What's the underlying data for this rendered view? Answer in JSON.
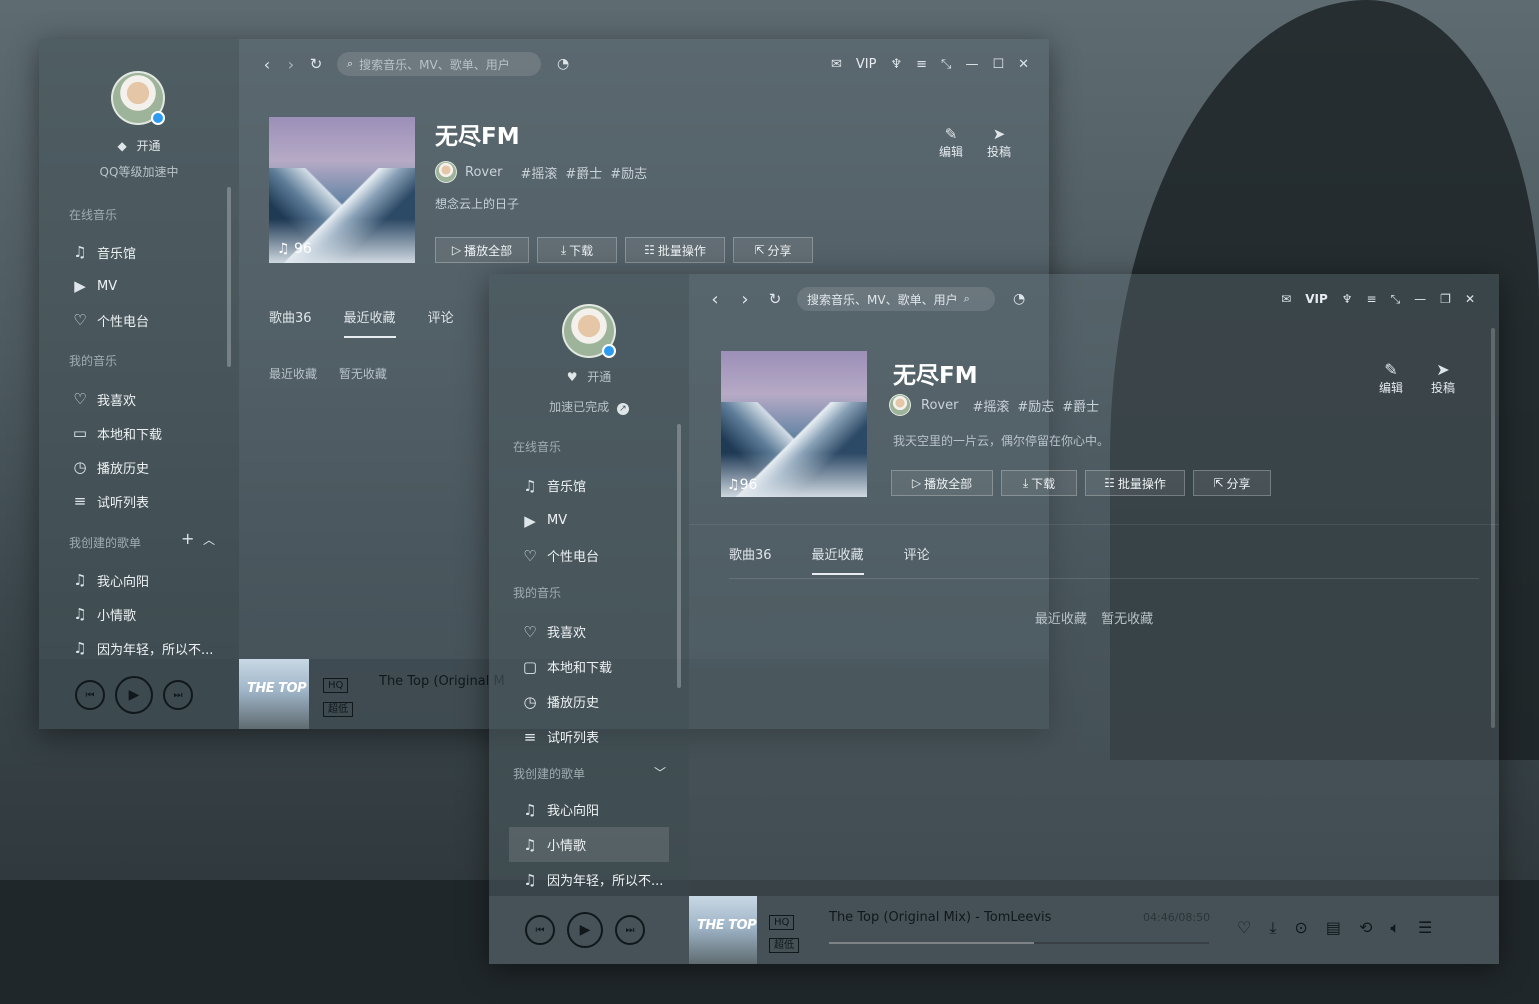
{
  "back": {
    "sidebar": {
      "vip": "开通",
      "level": "QQ等级加速中",
      "section_online": "在线音乐",
      "online_items": [
        {
          "icon": "music-hall-icon",
          "label": "音乐馆"
        },
        {
          "icon": "mv-icon",
          "label": "MV"
        },
        {
          "icon": "radio-icon",
          "label": "个性电台"
        }
      ],
      "section_mine": "我的音乐",
      "mine_items": [
        {
          "icon": "heart-icon",
          "label": "我喜欢"
        },
        {
          "icon": "monitor-icon",
          "label": "本地和下载"
        },
        {
          "icon": "clock-icon",
          "label": "播放历史"
        },
        {
          "icon": "playlist-icon",
          "label": "试听列表"
        }
      ],
      "section_created": "我创建的歌单",
      "created_items": [
        {
          "icon": "note-icon",
          "label": "我心向阳"
        },
        {
          "icon": "note-icon",
          "label": "小情歌"
        },
        {
          "icon": "note-icon",
          "label": "因为年轻，所以不..."
        }
      ]
    },
    "search_placeholder": "搜索音乐、MV、歌单、用户",
    "vip": "VIP",
    "playlist": {
      "title": "无尽FM",
      "plays": "96",
      "user": "Rover",
      "tags": [
        "#摇滚",
        "#爵士",
        "#励志"
      ],
      "desc": "想念云上的日子",
      "edit": "编辑",
      "submit": "投稿",
      "buttons": [
        "播放全部",
        "下载",
        "批量操作",
        "分享"
      ]
    },
    "tabs": [
      "歌曲36",
      "最近收藏",
      "评论"
    ],
    "empty": [
      "最近收藏",
      "暂无收藏"
    ],
    "player": {
      "thumb_text": "THE TOP",
      "quality_hq": "HQ",
      "quality_sq": "超低",
      "song": "The Top (Original M"
    }
  },
  "front": {
    "sidebar": {
      "vip": "开通",
      "level": "加速已完成",
      "section_online": "在线音乐",
      "online_items": [
        {
          "icon": "music-hall-icon",
          "label": "音乐馆"
        },
        {
          "icon": "mv-icon",
          "label": "MV"
        },
        {
          "icon": "radio-icon",
          "label": "个性电台"
        }
      ],
      "section_mine": "我的音乐",
      "mine_items": [
        {
          "icon": "heart-icon",
          "label": "我喜欢"
        },
        {
          "icon": "folder-icon",
          "label": "本地和下载"
        },
        {
          "icon": "clock-icon",
          "label": "播放历史"
        },
        {
          "icon": "playlist-icon",
          "label": "试听列表"
        }
      ],
      "section_created": "我创建的歌单",
      "created_items": [
        {
          "icon": "note-icon",
          "label": "我心向阳"
        },
        {
          "icon": "note-icon",
          "label": "小情歌"
        },
        {
          "icon": "note-icon",
          "label": "因为年轻，所以不..."
        }
      ]
    },
    "search_placeholder": "搜索音乐、MV、歌单、用户",
    "vip": "VIP",
    "playlist": {
      "title": "无尽FM",
      "plays": "96",
      "user": "Rover",
      "tags": [
        "#摇滚",
        "#励志",
        "#爵士"
      ],
      "desc": "我天空里的一片云，偶尔停留在你心中。",
      "edit": "编辑",
      "submit": "投稿",
      "buttons": [
        "播放全部",
        "下载",
        "批量操作",
        "分享"
      ]
    },
    "tabs": [
      "歌曲36",
      "最近收藏",
      "评论"
    ],
    "empty": [
      "最近收藏",
      "暂无收藏"
    ],
    "player": {
      "thumb_text": "THE TOP",
      "quality_hq": "HQ",
      "quality_sq": "超低",
      "song": "The Top (Original Mix) - TomLeevis",
      "time": "04:46/08:50",
      "progress": 0.54
    }
  },
  "colors": {
    "accent": "#2d9cf0",
    "sidebar": "#46545a",
    "text": "#e6ecef"
  }
}
